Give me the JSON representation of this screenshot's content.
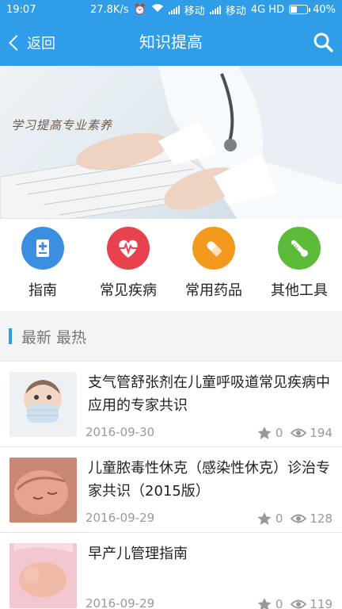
{
  "status_bar": {
    "time": "19:07",
    "net_speed": "27.8K/s",
    "carrier1": "移动",
    "carrier2": "移动",
    "network": "4G HD",
    "battery": "40%",
    "battery_level": 0.4
  },
  "nav": {
    "back_label": "返回",
    "title": "知识提高"
  },
  "banner": {
    "caption": "学习提高专业素养"
  },
  "categories": [
    {
      "label": "指南",
      "icon": "guide-book-icon",
      "color": "#3b8fe0"
    },
    {
      "label": "常见疾病",
      "icon": "heart-pulse-icon",
      "color": "#e8424f"
    },
    {
      "label": "常用药品",
      "icon": "pill-capsule-icon",
      "color": "#f39a1e"
    },
    {
      "label": "其他工具",
      "icon": "thermometer-icon",
      "color": "#5dbb3a"
    }
  ],
  "section": {
    "title": "最新 最热"
  },
  "articles": [
    {
      "title": "支气管舒张剂在儿童呼吸道常见疾病中应用的专家共识",
      "date": "2016-09-30",
      "stars": "0",
      "views": "194"
    },
    {
      "title": "儿童脓毒性休克（感染性休克）诊治专家共识（2015版）",
      "date": "2016-09-29",
      "stars": "0",
      "views": "128"
    },
    {
      "title": "早产儿管理指南",
      "date": "2016-09-29",
      "stars": "0",
      "views": "119"
    }
  ],
  "colors": {
    "primary": "#2f9de8",
    "meta_gray": "#999999"
  }
}
